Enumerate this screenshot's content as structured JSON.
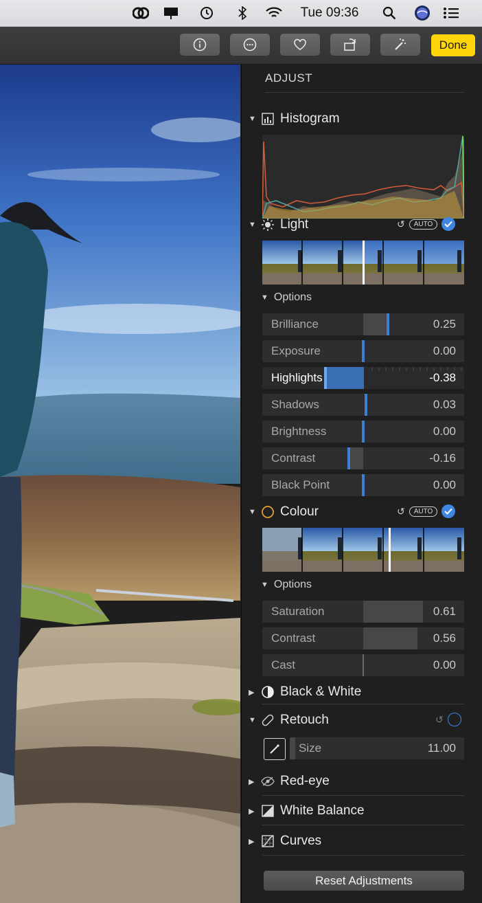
{
  "menubar": {
    "clock": "Tue 09:36"
  },
  "toolbar": {
    "done_label": "Done"
  },
  "sidebar": {
    "title": "ADJUST",
    "histogram": {
      "label": "Histogram"
    },
    "light": {
      "label": "Light",
      "auto_label": "AUTO",
      "options_label": "Options",
      "sliders": [
        {
          "label": "Brilliance",
          "value": "0.25"
        },
        {
          "label": "Exposure",
          "value": "0.00"
        },
        {
          "label": "Highlights",
          "value": "-0.38"
        },
        {
          "label": "Shadows",
          "value": "0.03"
        },
        {
          "label": "Brightness",
          "value": "0.00"
        },
        {
          "label": "Contrast",
          "value": "-0.16"
        },
        {
          "label": "Black Point",
          "value": "0.00"
        }
      ]
    },
    "colour": {
      "label": "Colour",
      "auto_label": "AUTO",
      "options_label": "Options",
      "sliders": [
        {
          "label": "Saturation",
          "value": "0.61"
        },
        {
          "label": "Contrast",
          "value": "0.56"
        },
        {
          "label": "Cast",
          "value": "0.00"
        }
      ]
    },
    "black_white": {
      "label": "Black & White"
    },
    "retouch": {
      "label": "Retouch",
      "size_label": "Size",
      "size_value": "11.00"
    },
    "red_eye": {
      "label": "Red-eye"
    },
    "white_balance": {
      "label": "White Balance"
    },
    "curves": {
      "label": "Curves"
    },
    "reset_label": "Reset Adjustments"
  },
  "colors": {
    "accent": "#3f86e0",
    "done": "#ffd60a",
    "panel": "#1f1f20"
  }
}
